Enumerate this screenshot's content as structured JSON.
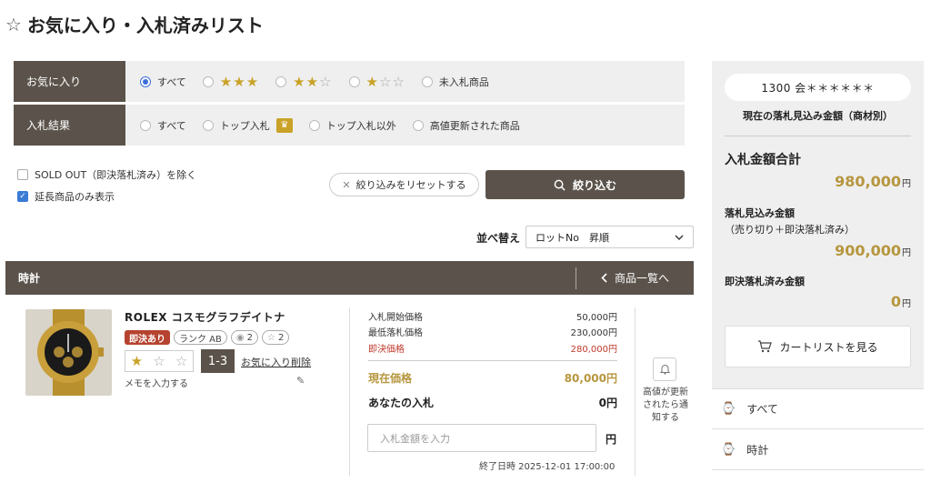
{
  "page": {
    "title": "お気に入り・入札済みリスト"
  },
  "filters": {
    "favorite_label": "お気に入り",
    "favorite_options": [
      "すべて",
      "★★★",
      "★★☆",
      "★☆☆",
      "未入札商品"
    ],
    "result_label": "入札結果",
    "result_options": [
      "すべて",
      "トップ入札",
      "トップ入札以外",
      "高値更新された商品"
    ],
    "sold_out_label": "SOLD OUT（即決落札済み）を除く",
    "extended_label": "延長商品のみ表示",
    "reset_label": "絞り込みをリセットする",
    "search_label": "絞り込む"
  },
  "sort": {
    "label": "並べ替え",
    "value": "ロットNo　昇順"
  },
  "category": {
    "title": "時計",
    "back_label": "商品一覧へ"
  },
  "item": {
    "name": "ROLEX コスモグラフデイトナ",
    "badge_instant": "即決あり",
    "badge_rank": "ランク AB",
    "views": "2",
    "favs": "2",
    "rating": 1,
    "lot": "1-3",
    "fav_delete": "お気に入り削除",
    "memo": "メモを入力する",
    "start_price_label": "入札開始価格",
    "start_price": "50,000円",
    "min_price_label": "最低落札価格",
    "min_price": "230,000円",
    "instant_price_label": "即決価格",
    "instant_price": "280,000円",
    "current_price_label": "現在価格",
    "current_price": "80,000円",
    "your_bid_label": "あなたの入札",
    "your_bid": "0円",
    "bid_placeholder": "入札金額を入力",
    "yen": "円",
    "end_date": "終了日時 2025-12-01 17:00:00",
    "notify_text": "高値が更新されたら通知する"
  },
  "summary": {
    "member": "1300 会＊＊＊＊＊＊",
    "estimate_label": "現在の落札見込み金額（商材別）",
    "total_label": "入札金額合計",
    "total_amount": "980,000",
    "expected_label": "落札見込み金額",
    "expected_sub": "（売り切り＋即決落札済み）",
    "expected_amount": "900,000",
    "instant_label": "即決落札済み金額",
    "instant_amount": "0",
    "yen": "円",
    "cart_label": "カートリストを見る"
  },
  "categories": [
    "すべて",
    "時計"
  ],
  "colors": {
    "brand": "#5b534b",
    "gold": "#b6963e",
    "red": "#b5432f",
    "accent": "#3a6fd8"
  }
}
